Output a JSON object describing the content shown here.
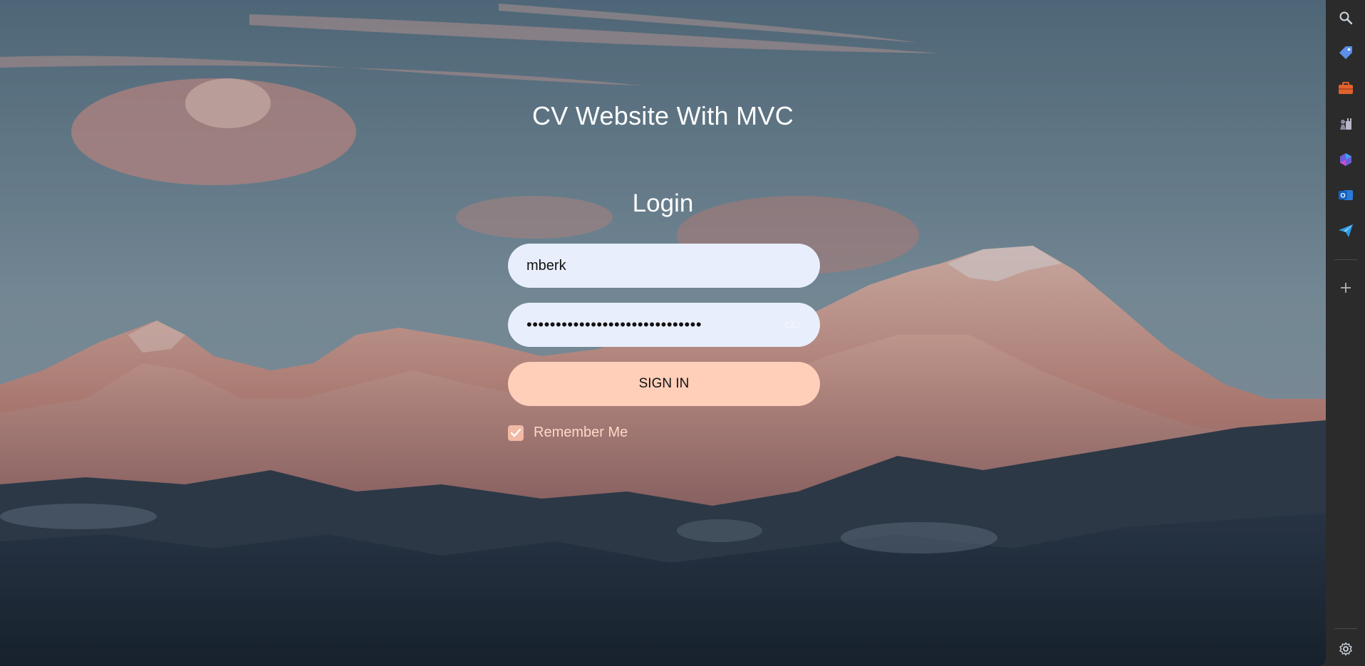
{
  "app": {
    "title": "CV Website With MVC"
  },
  "login": {
    "heading": "Login",
    "username_value": "mberk",
    "password_value": "••••••••••••••••••••••••••••••",
    "signin_label": "SIGN IN",
    "remember_label": "Remember Me",
    "remember_checked": true
  },
  "sidebar": {
    "icons": [
      "search-icon",
      "tag-icon",
      "briefcase-icon",
      "chess-icon",
      "copilot-icon",
      "outlook-icon",
      "send-icon",
      "add-icon",
      "settings-icon"
    ]
  },
  "colors": {
    "field_bg": "#e8eefc",
    "signin_bg": "#ffcfba",
    "remember_text": "#ffd8c6",
    "sidebar_bg": "#2b2b2b"
  }
}
